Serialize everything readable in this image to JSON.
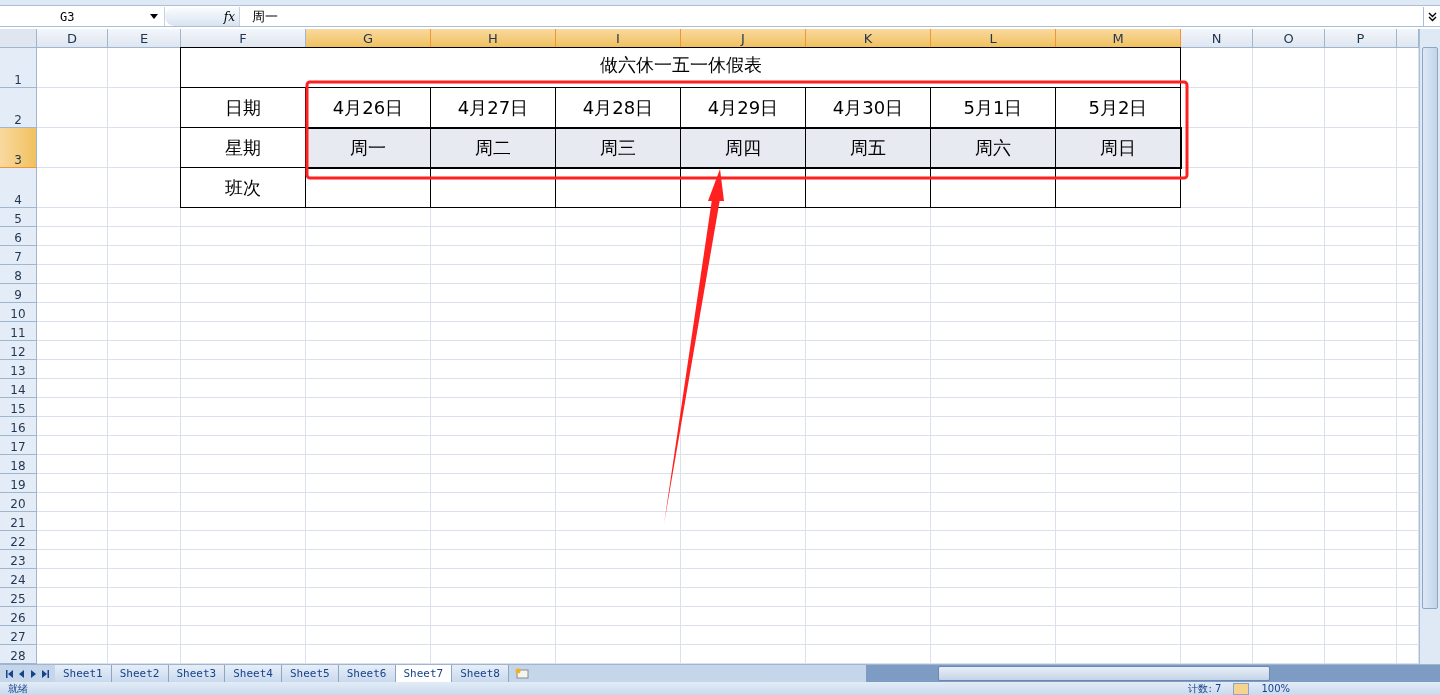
{
  "formula_bar": {
    "name_box": "G3",
    "function_label": "fx",
    "formula": "周一"
  },
  "column_headers": [
    {
      "label": "D",
      "selected": false
    },
    {
      "label": "E",
      "selected": false
    },
    {
      "label": "F",
      "selected": false
    },
    {
      "label": "G",
      "selected": true
    },
    {
      "label": "H",
      "selected": true
    },
    {
      "label": "I",
      "selected": true
    },
    {
      "label": "J",
      "selected": true
    },
    {
      "label": "K",
      "selected": true
    },
    {
      "label": "L",
      "selected": true
    },
    {
      "label": "M",
      "selected": true
    },
    {
      "label": "N",
      "selected": false
    },
    {
      "label": "O",
      "selected": false
    },
    {
      "label": "P",
      "selected": false
    }
  ],
  "row_headers": [
    {
      "label": "1",
      "selected": false
    },
    {
      "label": "2",
      "selected": false
    },
    {
      "label": "3",
      "selected": true
    },
    {
      "label": "4",
      "selected": false
    },
    {
      "label": "5",
      "selected": false
    },
    {
      "label": "6",
      "selected": false
    },
    {
      "label": "7",
      "selected": false
    },
    {
      "label": "8",
      "selected": false
    },
    {
      "label": "9",
      "selected": false
    },
    {
      "label": "10",
      "selected": false
    },
    {
      "label": "11",
      "selected": false
    },
    {
      "label": "12",
      "selected": false
    },
    {
      "label": "13",
      "selected": false
    },
    {
      "label": "14",
      "selected": false
    },
    {
      "label": "15",
      "selected": false
    },
    {
      "label": "16",
      "selected": false
    },
    {
      "label": "17",
      "selected": false
    },
    {
      "label": "18",
      "selected": false
    },
    {
      "label": "19",
      "selected": false
    },
    {
      "label": "20",
      "selected": false
    },
    {
      "label": "21",
      "selected": false
    },
    {
      "label": "22",
      "selected": false
    },
    {
      "label": "23",
      "selected": false
    },
    {
      "label": "24",
      "selected": false
    },
    {
      "label": "25",
      "selected": false
    },
    {
      "label": "26",
      "selected": false
    },
    {
      "label": "27",
      "selected": false
    },
    {
      "label": "28",
      "selected": false
    }
  ],
  "table": {
    "title": "做六休一五一休假表",
    "rows": [
      {
        "label": "日期",
        "cells": [
          {
            "text": "4月26日",
            "selected": false
          },
          {
            "text": "4月27日",
            "selected": false
          },
          {
            "text": "4月28日",
            "selected": false
          },
          {
            "text": "4月29日",
            "selected": false
          },
          {
            "text": "4月30日",
            "selected": false
          },
          {
            "text": "5月1日",
            "selected": false
          },
          {
            "text": "5月2日",
            "selected": false
          }
        ]
      },
      {
        "label": "星期",
        "cells": [
          {
            "text": "周一",
            "selected": true
          },
          {
            "text": "周二",
            "selected": true
          },
          {
            "text": "周三",
            "selected": true
          },
          {
            "text": "周四",
            "selected": true
          },
          {
            "text": "周五",
            "selected": true
          },
          {
            "text": "周六",
            "selected": true
          },
          {
            "text": "周日",
            "selected": true
          }
        ]
      },
      {
        "label": "班次"
      }
    ]
  },
  "sheet_tabs": [
    {
      "label": "Sheet1",
      "selected": false
    },
    {
      "label": "Sheet2",
      "selected": false
    },
    {
      "label": "Sheet3",
      "selected": false
    },
    {
      "label": "Sheet4",
      "selected": false
    },
    {
      "label": "Sheet5",
      "selected": false
    },
    {
      "label": "Sheet6",
      "selected": false
    },
    {
      "label": "Sheet7",
      "selected": true
    },
    {
      "label": "Sheet8",
      "selected": false
    }
  ],
  "status_bar": {
    "status": "就绪",
    "count": "计数: 7",
    "zoom": "100%"
  }
}
